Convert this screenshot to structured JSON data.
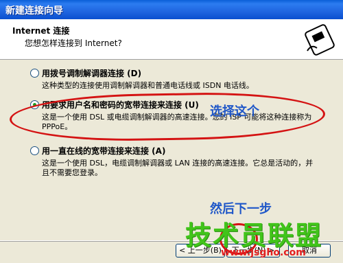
{
  "window": {
    "title": "新建连接向导"
  },
  "header": {
    "title": "Internet 连接",
    "subtitle": "您想怎样连接到 Internet?"
  },
  "options": [
    {
      "label": "用拨号调制解调器连接 (D)",
      "desc": "这种类型的连接使用调制解调器和普通电话线或 ISDN 电话线。",
      "selected": false
    },
    {
      "label": "用要求用户名和密码的宽带连接来连接 (U)",
      "desc": "这是一个使用 DSL 或电缆调制解调器的高速连接。您的 ISP 可能将这种连接称为 PPPoE。",
      "selected": true
    },
    {
      "label": "用一直在线的宽带连接来连接 (A)",
      "desc": "这是一个使用 DSL，电缆调制解调器或 LAN 连接的高速连接。它总是活动的，并且不需要您登录。",
      "selected": false
    }
  ],
  "annotations": {
    "note1": "选择这个",
    "note2": "然后下一步"
  },
  "buttons": {
    "back": "< 上一步(B)",
    "next": "下一步(N) >",
    "cancel": "取消"
  },
  "watermark": {
    "text": "技术员联盟",
    "url": "www.jsgho.com"
  }
}
